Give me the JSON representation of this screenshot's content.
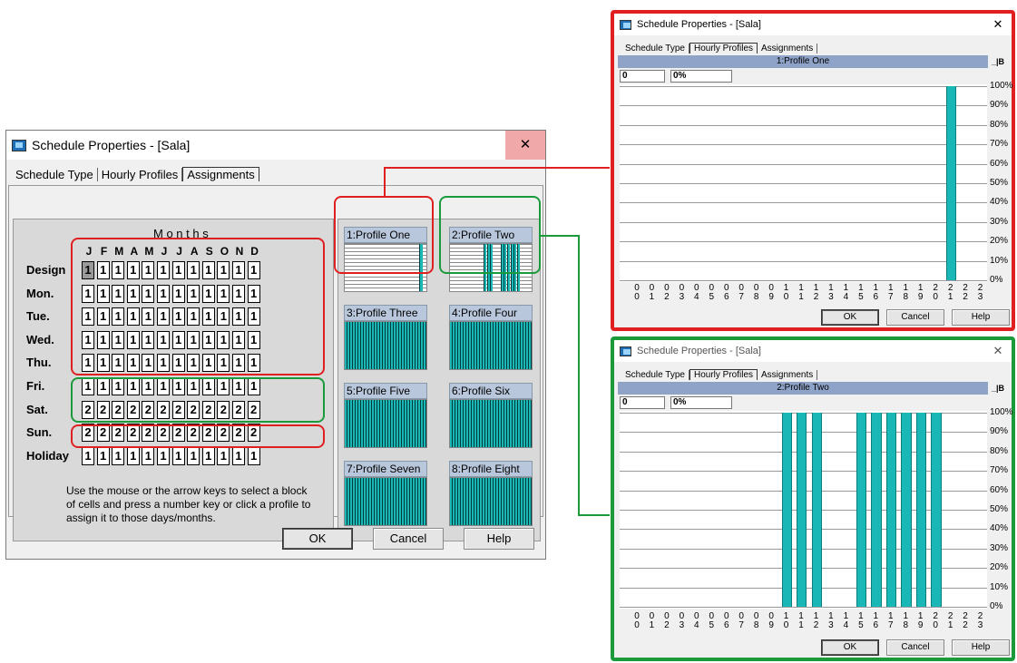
{
  "main": {
    "title": "Schedule Properties - [Sala]",
    "close": "✕",
    "tabs": [
      "Schedule Type",
      "Hourly Profiles",
      "Assignments"
    ],
    "months_title": "M o n t h s",
    "months": [
      "J",
      "F",
      "M",
      "A",
      "M",
      "J",
      "J",
      "A",
      "S",
      "O",
      "N",
      "D"
    ],
    "rows": [
      {
        "label": "Design",
        "values": [
          "1",
          "1",
          "1",
          "1",
          "1",
          "1",
          "1",
          "1",
          "1",
          "1",
          "1",
          "1"
        ]
      },
      {
        "label": "Mon.",
        "values": [
          "1",
          "1",
          "1",
          "1",
          "1",
          "1",
          "1",
          "1",
          "1",
          "1",
          "1",
          "1"
        ]
      },
      {
        "label": "Tue.",
        "values": [
          "1",
          "1",
          "1",
          "1",
          "1",
          "1",
          "1",
          "1",
          "1",
          "1",
          "1",
          "1"
        ]
      },
      {
        "label": "Wed.",
        "values": [
          "1",
          "1",
          "1",
          "1",
          "1",
          "1",
          "1",
          "1",
          "1",
          "1",
          "1",
          "1"
        ]
      },
      {
        "label": "Thu.",
        "values": [
          "1",
          "1",
          "1",
          "1",
          "1",
          "1",
          "1",
          "1",
          "1",
          "1",
          "1",
          "1"
        ]
      },
      {
        "label": "Fri.",
        "values": [
          "1",
          "1",
          "1",
          "1",
          "1",
          "1",
          "1",
          "1",
          "1",
          "1",
          "1",
          "1"
        ]
      },
      {
        "label": "Sat.",
        "values": [
          "2",
          "2",
          "2",
          "2",
          "2",
          "2",
          "2",
          "2",
          "2",
          "2",
          "2",
          "2"
        ]
      },
      {
        "label": "Sun.",
        "values": [
          "2",
          "2",
          "2",
          "2",
          "2",
          "2",
          "2",
          "2",
          "2",
          "2",
          "2",
          "2"
        ]
      },
      {
        "label": "Holiday",
        "values": [
          "1",
          "1",
          "1",
          "1",
          "1",
          "1",
          "1",
          "1",
          "1",
          "1",
          "1",
          "1"
        ]
      }
    ],
    "instructions": "Use the mouse or the arrow keys to select a block of cells and press a number key or click a profile to assign it to those days/months.",
    "profiles": [
      "1:Profile One",
      "2:Profile Two",
      "3:Profile Three",
      "4:Profile Four",
      "5:Profile Five",
      "6:Profile Six",
      "7:Profile Seven",
      "8:Profile Eight"
    ],
    "buttons": {
      "ok": "OK",
      "cancel": "Cancel",
      "help": "Help"
    }
  },
  "chart_windows": [
    {
      "title": "Schedule Properties - [Sala]",
      "close": "✕",
      "tabs": [
        "Schedule Type",
        "Hourly Profiles",
        "Assignments"
      ],
      "profile_header": "1:Profile One",
      "header_buttons": "_|B",
      "field_value": "0",
      "field_percent": "0%",
      "buttons": {
        "ok": "OK",
        "cancel": "Cancel",
        "help": "Help"
      },
      "accent": "#e02020"
    },
    {
      "title": "Schedule Properties - [Sala]",
      "close": "✕",
      "tabs": [
        "Schedule Type",
        "Hourly Profiles",
        "Assignments"
      ],
      "profile_header": "2:Profile Two",
      "header_buttons": "_|B",
      "field_value": "0",
      "field_percent": "0%",
      "buttons": {
        "ok": "OK",
        "cancel": "Cancel",
        "help": "Help"
      },
      "accent": "#1a9a3a"
    }
  ],
  "chart_data": [
    {
      "type": "bar",
      "x": [
        "00",
        "01",
        "02",
        "03",
        "04",
        "05",
        "06",
        "07",
        "08",
        "09",
        "10",
        "11",
        "12",
        "13",
        "14",
        "15",
        "16",
        "17",
        "18",
        "19",
        "20",
        "21",
        "22",
        "23"
      ],
      "values": [
        0,
        0,
        0,
        0,
        0,
        0,
        0,
        0,
        0,
        0,
        0,
        0,
        0,
        0,
        0,
        0,
        0,
        0,
        0,
        0,
        0,
        100,
        0,
        0
      ],
      "ylim": [
        0,
        100
      ],
      "yticks": [
        "100%",
        "90%",
        "80%",
        "70%",
        "60%",
        "50%",
        "40%",
        "30%",
        "20%",
        "10%",
        "0%"
      ],
      "color": "#1ab7b7"
    },
    {
      "type": "bar",
      "x": [
        "00",
        "01",
        "02",
        "03",
        "04",
        "05",
        "06",
        "07",
        "08",
        "09",
        "10",
        "11",
        "12",
        "13",
        "14",
        "15",
        "16",
        "17",
        "18",
        "19",
        "20",
        "21",
        "22",
        "23"
      ],
      "values": [
        0,
        0,
        0,
        0,
        0,
        0,
        0,
        0,
        0,
        0,
        100,
        100,
        100,
        0,
        0,
        100,
        100,
        100,
        100,
        100,
        100,
        0,
        0,
        0
      ],
      "ylim": [
        0,
        100
      ],
      "yticks": [
        "100%",
        "90%",
        "80%",
        "70%",
        "60%",
        "50%",
        "40%",
        "30%",
        "20%",
        "10%",
        "0%"
      ],
      "color": "#1ab7b7"
    }
  ],
  "colors": {
    "red_outline": "#e02020",
    "green_outline": "#1a9a3a",
    "teal": "#1ab7b7",
    "profile_label_bg": "#b9c7dc"
  }
}
